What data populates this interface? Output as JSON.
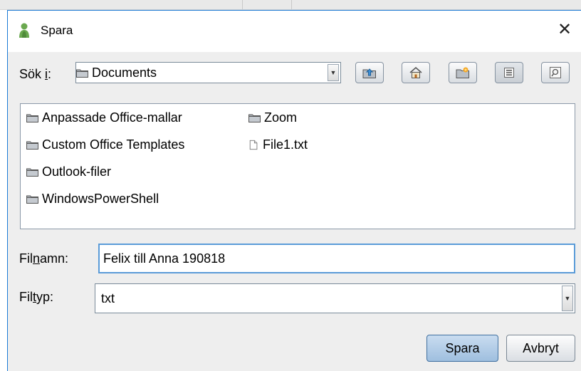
{
  "dialog": {
    "title": "Spara",
    "close_symbol": "✕",
    "app_icon": "person-icon"
  },
  "look_in": {
    "label_prefix": "Sök ",
    "label_mnemonic": "i",
    "label_suffix": ":",
    "selected": "Documents",
    "arrow": "▼"
  },
  "toolbar": {
    "buttons": [
      "up-one-level-icon",
      "home-icon",
      "new-folder-icon",
      "list-view-icon",
      "details-view-icon"
    ]
  },
  "files": [
    {
      "name": "Anpassade Office-mallar",
      "type": "folder"
    },
    {
      "name": "Custom Office Templates",
      "type": "folder"
    },
    {
      "name": "Outlook-filer",
      "type": "folder"
    },
    {
      "name": "WindowsPowerShell",
      "type": "folder"
    },
    {
      "name": "Zoom",
      "type": "folder"
    },
    {
      "name": "File1.txt",
      "type": "file"
    }
  ],
  "filename": {
    "label_prefix": "Fil",
    "label_mnemonic": "n",
    "label_suffix": "amn:",
    "value": "Felix till Anna 190818"
  },
  "filetype": {
    "label_prefix": "Fil",
    "label_mnemonic": "t",
    "label_suffix": "yp:",
    "selected": "txt",
    "arrow": "▼"
  },
  "actions": {
    "save_label": "Spara",
    "cancel_label": "Avbryt"
  },
  "colors": {
    "accent_border": "#1a7ad6",
    "dialog_bg": "#eeeeee",
    "focus_border": "#5a9bd8"
  }
}
